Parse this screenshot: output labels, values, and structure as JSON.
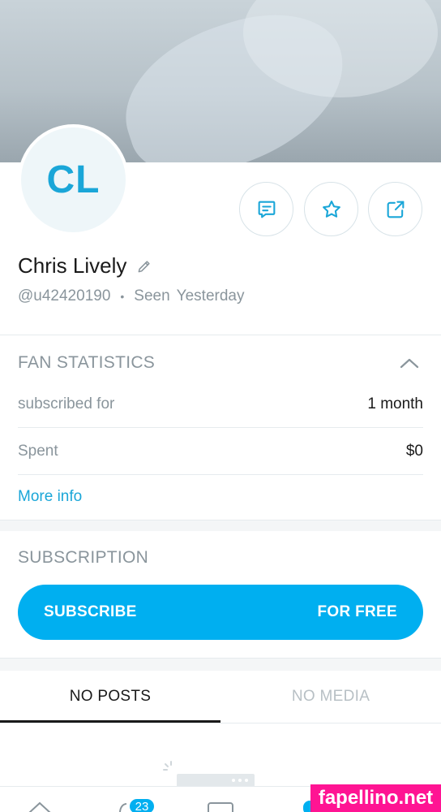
{
  "profile": {
    "initials": "CL",
    "name": "Chris Lively",
    "username": "@u42420190",
    "seen_word": "Seen",
    "seen_time": "Yesterday"
  },
  "fan_statistics": {
    "title": "FAN STATISTICS",
    "rows": [
      {
        "label": "subscribed for",
        "value": "1 month"
      },
      {
        "label": "Spent",
        "value": "$0"
      }
    ],
    "more_info": "More info"
  },
  "subscription": {
    "title": "SUBSCRIPTION",
    "button_left": "SUBSCRIBE",
    "button_right": "FOR FREE"
  },
  "tabs": [
    {
      "label": "NO POSTS",
      "active": true
    },
    {
      "label": "NO MEDIA",
      "active": false
    }
  ],
  "bottom_nav": {
    "notifications_badge": "23"
  },
  "watermark": "fapellino.net",
  "colors": {
    "accent": "#00aff0",
    "link": "#1aa6d8",
    "muted": "#8a959c",
    "watermark": "#ff1493"
  }
}
